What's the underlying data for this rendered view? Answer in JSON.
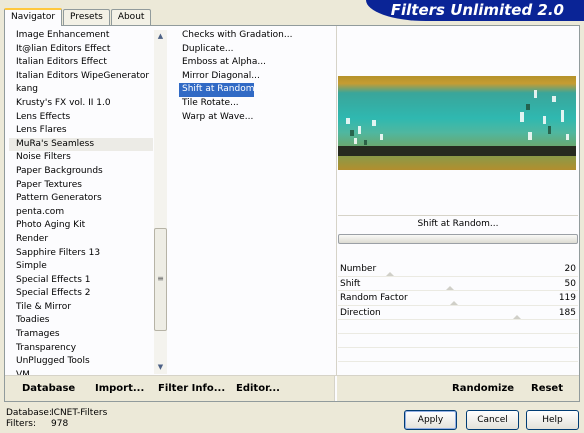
{
  "tabs": [
    "Navigator",
    "Presets",
    "About"
  ],
  "banner_title": "Filters Unlimited 2.0",
  "filter_categories": [
    "Image Enhancement",
    "It@lian Editors Effect",
    "Italian Editors Effect",
    "Italian Editors WipeGenerator",
    "kang",
    "Krusty's FX vol. II 1.0",
    "Lens Effects",
    "Lens Flares",
    "MuRa's Seamless",
    "Noise Filters",
    "Paper Backgrounds",
    "Paper Textures",
    "Pattern Generators",
    "penta.com",
    "Photo Aging Kit",
    "Render",
    "Sapphire Filters 13",
    "Simple",
    "Special Effects 1",
    "Special Effects 2",
    "Tile & Mirror",
    "Toadies",
    "Tramages",
    "Transparency",
    "UnPlugged Tools",
    "VM"
  ],
  "selected_category": "MuRa's Seamless",
  "effects": [
    "Checks with Gradation...",
    "Duplicate...",
    "Emboss at Alpha...",
    "Mirror Diagonal...",
    "Shift at Random...",
    "Tile Rotate...",
    "Warp at Wave..."
  ],
  "selected_effect": "Shift at Random...",
  "effect_name_button": "Shift at Random...",
  "params": [
    {
      "name": "Number",
      "value": "20"
    },
    {
      "name": "Shift",
      "value": "50"
    },
    {
      "name": "Random Factor",
      "value": "119"
    },
    {
      "name": "Direction",
      "value": "185"
    }
  ],
  "bottom_left_buttons": {
    "database": "Database",
    "import": "Import...",
    "filter_info": "Filter Info...",
    "editor": "Editor..."
  },
  "bottom_right_buttons": {
    "randomize": "Randomize",
    "reset": "Reset"
  },
  "status": {
    "database_label": "Database:",
    "database_value": "ICNET-Filters",
    "filters_label": "Filters:",
    "filters_value": "978"
  },
  "dialog_buttons": {
    "apply": "Apply",
    "cancel": "Cancel",
    "help": "Help"
  },
  "icons": {
    "scroll_up": "scroll-up-arrow",
    "scroll_down": "scroll-down-arrow",
    "grip": "scroll-grip"
  }
}
